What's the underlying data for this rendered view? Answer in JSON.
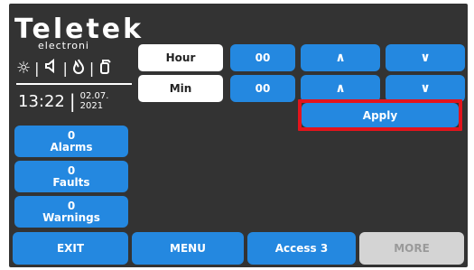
{
  "brand": {
    "name": "Teletek",
    "tagline": "electroni"
  },
  "status_icons": [
    "sun-icon",
    "speaker-icon",
    "flame-icon",
    "extinguisher-icon"
  ],
  "clock": {
    "time": "13:22",
    "date_top": "02.07.",
    "date_bottom": "2021"
  },
  "side": {
    "alarms": {
      "count": "0",
      "label": "Alarms"
    },
    "faults": {
      "count": "0",
      "label": "Faults"
    },
    "warnings": {
      "count": "0",
      "label": "Warnings"
    }
  },
  "time_setting": {
    "hour": {
      "label": "Hour",
      "value": "00",
      "up": "∧",
      "down": "∨"
    },
    "min": {
      "label": "Min",
      "value": "00",
      "up": "∧",
      "down": "∨"
    },
    "apply_label": "Apply"
  },
  "bottom_bar": {
    "exit": "EXIT",
    "menu": "MENU",
    "access": "Access 3",
    "more": "MORE"
  },
  "colors": {
    "background": "#333333",
    "button_blue": "#2488e0",
    "highlight_red": "#e3141c",
    "disabled_gray": "#d4d4d4"
  }
}
